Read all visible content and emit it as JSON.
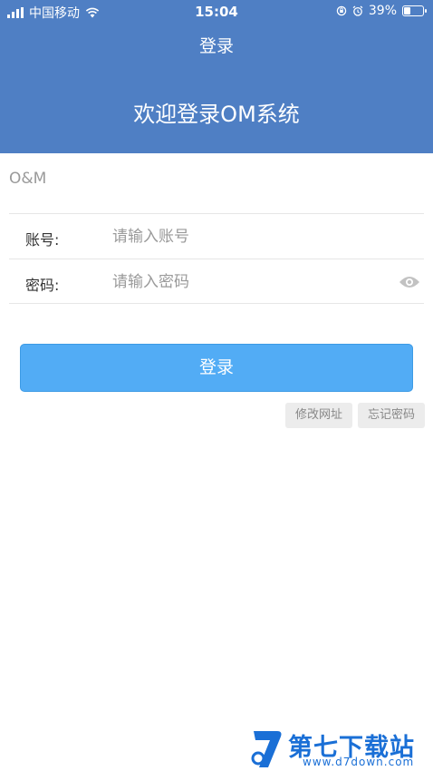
{
  "status_bar": {
    "carrier": "中国移动",
    "time": "15:04",
    "battery_percent": "39%",
    "battery_level": 0.39
  },
  "header": {
    "nav_title": "登录",
    "welcome_text": "欢迎登录OM系统"
  },
  "brand": "O&M",
  "form": {
    "account": {
      "label": "账号:",
      "placeholder": "请输入账号"
    },
    "password": {
      "label": "密码:",
      "placeholder": "请输入密码"
    }
  },
  "login_button": "登录",
  "links": {
    "modify_url": "修改网址",
    "forgot_password": "忘记密码"
  },
  "watermark": {
    "name": "第七下载站",
    "url": "www.d7down.com"
  },
  "colors": {
    "header_bg": "#4f7fc4",
    "button_bg": "#52acf5",
    "watermark": "#1a6fd6"
  }
}
